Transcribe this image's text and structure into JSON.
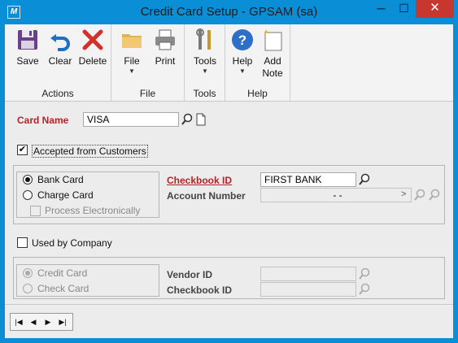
{
  "window": {
    "title": "Credit Card Setup  -  GPSAM (sa)",
    "app_icon_glyph": "M",
    "minimize_glyph": "─",
    "maximize_glyph": "☐",
    "close_glyph": "✕"
  },
  "ribbon": {
    "groups": [
      {
        "name": "Actions",
        "buttons": [
          "Save",
          "Clear",
          "Delete"
        ]
      },
      {
        "name": "File",
        "buttons": [
          "File",
          "Print"
        ]
      },
      {
        "name": "Tools",
        "buttons": [
          "Tools"
        ]
      },
      {
        "name": "Help",
        "buttons": [
          "Help",
          "Add Note"
        ]
      }
    ],
    "save": "Save",
    "clear": "Clear",
    "delete": "Delete",
    "file": "File",
    "print": "Print",
    "tools": "Tools",
    "help": "Help",
    "add_note_line1": "Add",
    "add_note_line2": "Note",
    "group_actions": "Actions",
    "group_file": "File",
    "group_tools": "Tools",
    "group_help": "Help",
    "dropdown_glyph": "▼"
  },
  "form": {
    "card_name_label": "Card Name",
    "card_name_value": "VISA",
    "accepted_label": "Accepted from Customers",
    "accepted_checked": true,
    "check_glyph": "✔",
    "bank_card_label": "Bank Card",
    "charge_card_label": "Charge Card",
    "process_electronically_label": "Process Electronically",
    "checkbook_id_label": "Checkbook ID",
    "checkbook_id_value": "FIRST BANK",
    "account_number_label": "Account Number",
    "account_number_value": "-          -",
    "account_number_expand": ">",
    "used_by_company_label": "Used by Company",
    "credit_card_label": "Credit Card",
    "check_card_label": "Check Card",
    "vendor_id_label": "Vendor ID",
    "checkbook_id2_label": "Checkbook ID"
  },
  "nav": {
    "first": "|◀",
    "prev": "◀",
    "next": "▶",
    "last": "▶|"
  },
  "colors": {
    "title_bar": "#0a8fd6",
    "close_button": "#c7372f",
    "required_label": "#b3232a",
    "client_bg": "#ececec"
  }
}
